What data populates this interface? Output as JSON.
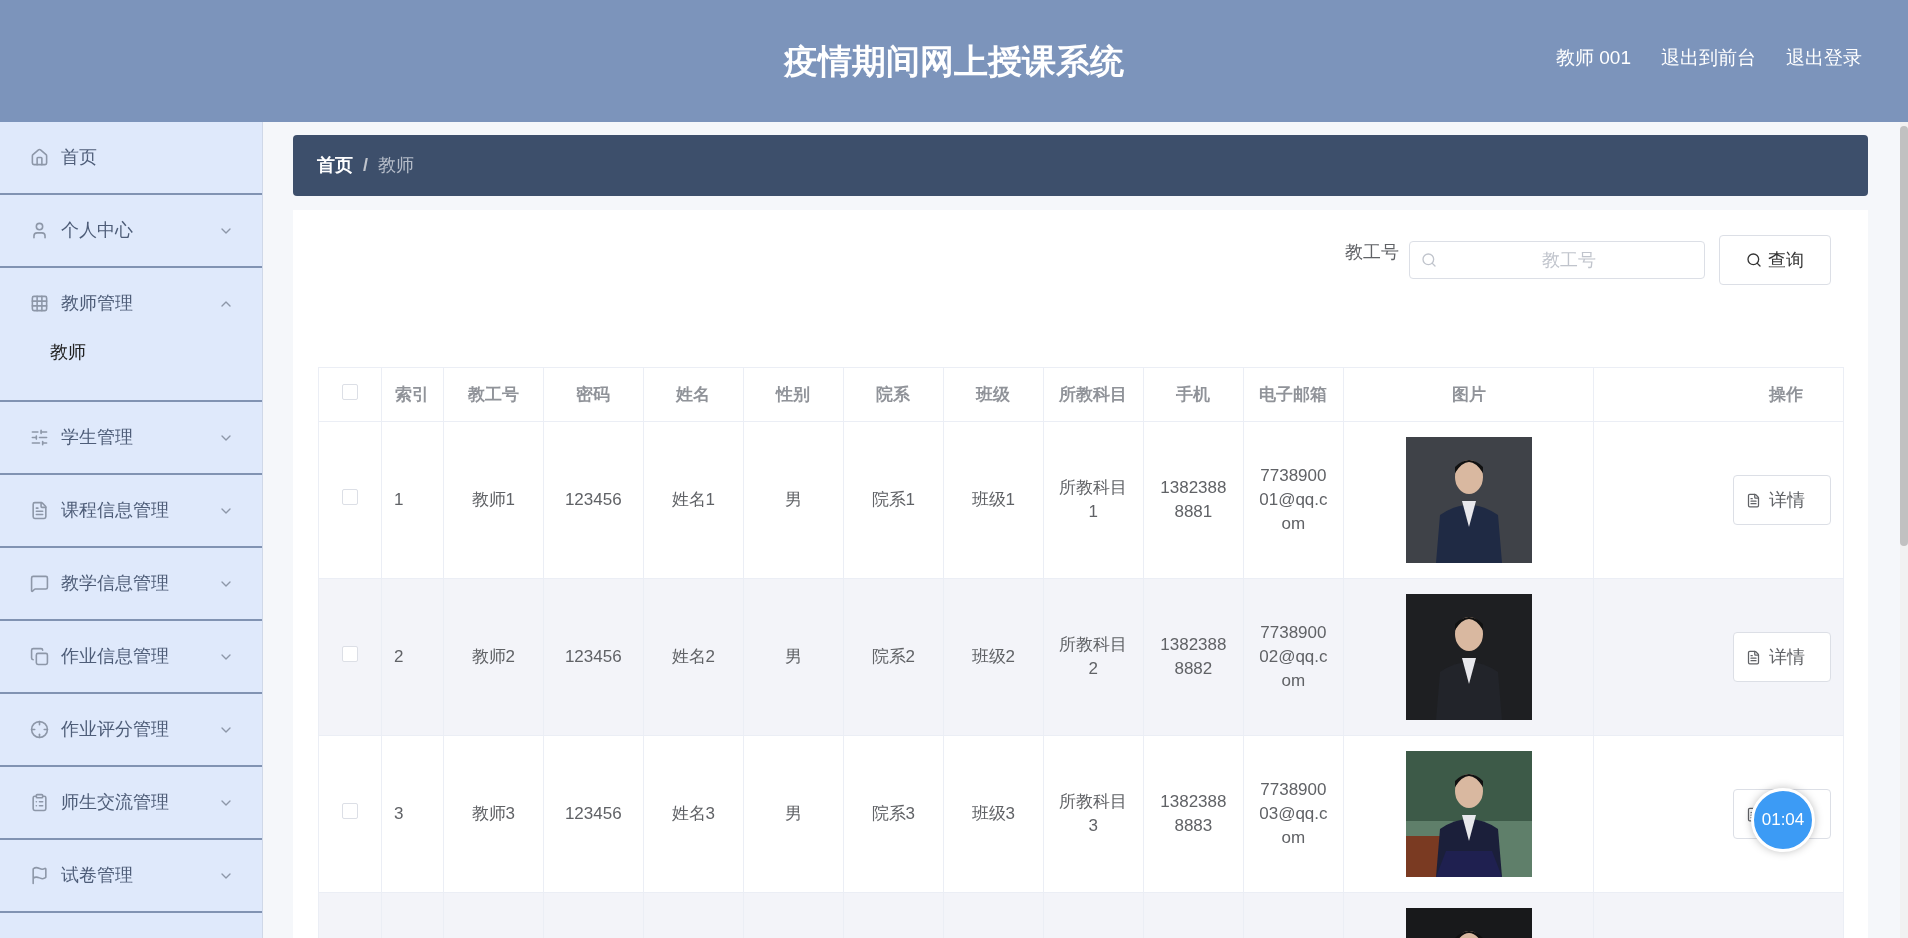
{
  "header": {
    "title": "疫情期间网上授课系统",
    "links": [
      "教师 001",
      "退出到前台",
      "退出登录"
    ]
  },
  "sidebar": {
    "items": [
      {
        "label": "首页"
      },
      {
        "label": "个人中心",
        "expanded": false
      },
      {
        "label": "教师管理",
        "expanded": true,
        "children": [
          {
            "label": "教师",
            "selected": true
          }
        ]
      },
      {
        "label": "学生管理",
        "expanded": false
      },
      {
        "label": "课程信息管理",
        "expanded": false
      },
      {
        "label": "教学信息管理",
        "expanded": false
      },
      {
        "label": "作业信息管理",
        "expanded": false
      },
      {
        "label": "作业评分管理",
        "expanded": false
      },
      {
        "label": "师生交流管理",
        "expanded": false
      },
      {
        "label": "试卷管理",
        "expanded": false
      }
    ]
  },
  "breadcrumb": {
    "items": [
      "首页",
      "教师"
    ],
    "separator": "/"
  },
  "search": {
    "label": "教工号",
    "placeholder": "教工号",
    "button": "查询"
  },
  "table": {
    "header_checked": false,
    "columns": [
      "索引",
      "教工号",
      "密码",
      "姓名",
      "性别",
      "院系",
      "班级",
      "所教科目",
      "手机",
      "电子邮箱",
      "图片",
      "操作"
    ],
    "rows": [
      {
        "checked": false,
        "cells": [
          "1",
          "教师1",
          "123456",
          "姓名1",
          "男",
          "院系1",
          "班级1",
          "所教科目1",
          "13823888881",
          "773890001@qq.com"
        ],
        "photo": {
          "kind": "picture"
        },
        "action": "详情"
      },
      {
        "checked": false,
        "cells": [
          "2",
          "教师2",
          "123456",
          "姓名2",
          "男",
          "院系2",
          "班级2",
          "所教科目2",
          "13823888882",
          "773890002@qq.com"
        ],
        "photo": {
          "kind": "picture"
        },
        "action": "详情"
      },
      {
        "checked": false,
        "cells": [
          "3",
          "教师3",
          "123456",
          "姓名3",
          "男",
          "院系3",
          "班级3",
          "所教科目3",
          "13823888883",
          "773890003@qq.com"
        ],
        "photo": {
          "kind": "picture"
        },
        "details_button": true
      },
      {
        "photo": {
          "kind": "picture"
        }
      }
    ]
  },
  "timer": "01:04"
}
